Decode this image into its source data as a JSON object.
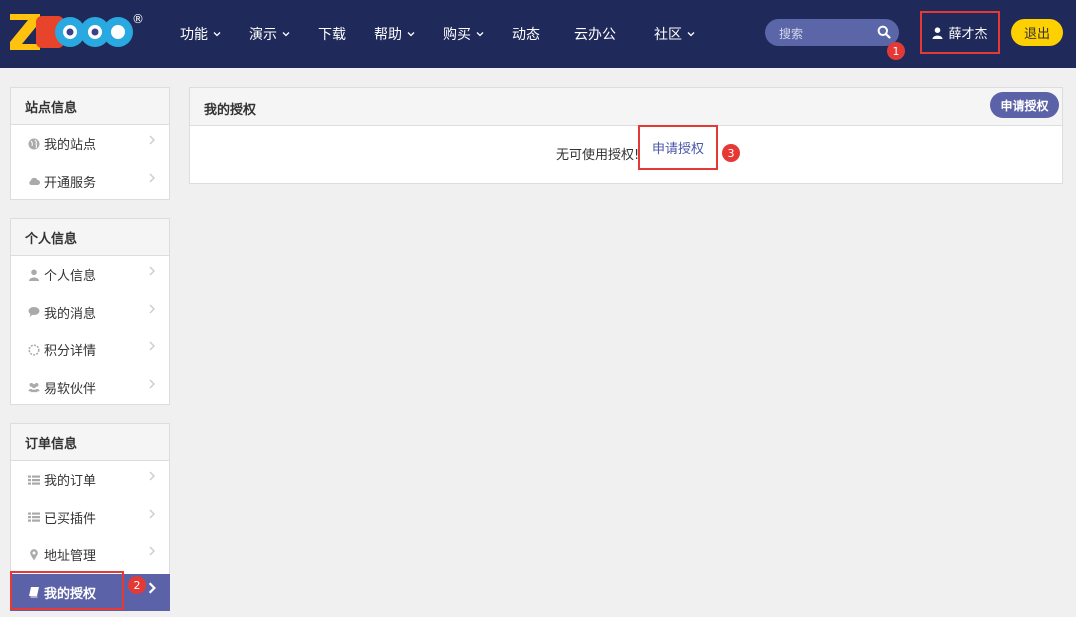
{
  "header": {
    "logo_text": "ZDOO",
    "logo_reg": "®",
    "nav": [
      {
        "label": "功能",
        "dropdown": true
      },
      {
        "label": "演示",
        "dropdown": true
      },
      {
        "label": "下载",
        "dropdown": false
      },
      {
        "label": "帮助",
        "dropdown": true
      },
      {
        "label": "购买",
        "dropdown": true
      },
      {
        "label": "动态",
        "dropdown": false
      },
      {
        "label": "云办公",
        "dropdown": false
      },
      {
        "label": "社区",
        "dropdown": true
      }
    ],
    "search_placeholder": "搜索",
    "user_name": "薛才杰",
    "logout_label": "退出"
  },
  "badges": {
    "one": "1",
    "two": "2",
    "three": "3"
  },
  "sidebar": {
    "site": {
      "title": "站点信息",
      "items": [
        {
          "label": "我的站点",
          "icon": "globe-icon"
        },
        {
          "label": "开通服务",
          "icon": "cloud-icon"
        }
      ]
    },
    "personal": {
      "title": "个人信息",
      "items": [
        {
          "label": "个人信息",
          "icon": "user-icon"
        },
        {
          "label": "我的消息",
          "icon": "comment-icon"
        },
        {
          "label": "积分详情",
          "icon": "spinner-icon"
        },
        {
          "label": "易软伙伴",
          "icon": "group-icon"
        }
      ]
    },
    "orders": {
      "title": "订单信息",
      "items": [
        {
          "label": "我的订单",
          "icon": "list-icon"
        },
        {
          "label": "已买插件",
          "icon": "list-icon"
        },
        {
          "label": "地址管理",
          "icon": "map-marker-icon"
        },
        {
          "label": "我的授权",
          "icon": "book-icon",
          "active": true
        }
      ]
    }
  },
  "main": {
    "title": "我的授权",
    "apply_button": "申请授权",
    "empty_message": "无可使用授权!",
    "apply_link": "申请授权"
  },
  "colors": {
    "header_bg": "#1f2a5a",
    "accent": "#5b62a7",
    "logout_bg": "#ffd000",
    "highlight": "#e53935"
  }
}
